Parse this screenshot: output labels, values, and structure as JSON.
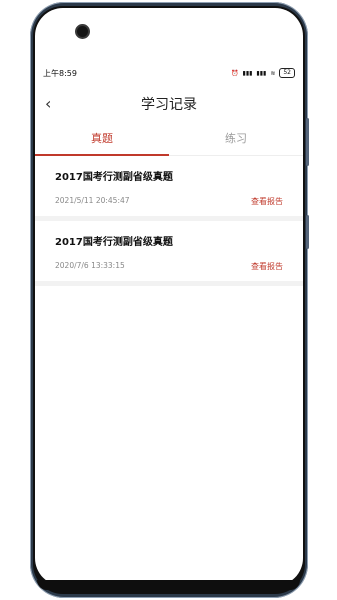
{
  "status": {
    "time": "上午8:59",
    "battery": "52"
  },
  "header": {
    "back_icon": "chevron-left-icon",
    "title": "学习记录"
  },
  "tabs": [
    {
      "label": "真题",
      "active": true
    },
    {
      "label": "练习",
      "active": false
    }
  ],
  "records": [
    {
      "title": "2017国考行测副省级真题",
      "time": "2021/5/11  20:45:47",
      "action": "查看报告"
    },
    {
      "title": "2017国考行测副省级真题",
      "time": "2020/7/6  13:33:15",
      "action": "查看报告"
    }
  ],
  "colors": {
    "accent": "#c0392b",
    "text": "#222222",
    "muted": "#888888"
  }
}
